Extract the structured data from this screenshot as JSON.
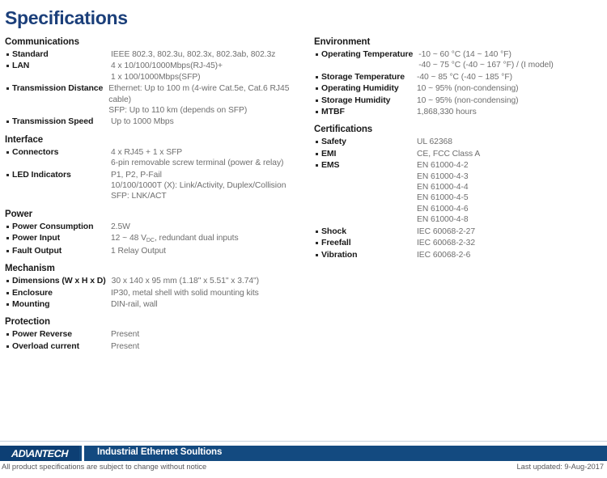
{
  "title": "Specifications",
  "theme": {
    "title_color": "#1b3f7a",
    "footer_bar_color": "#134a80",
    "logo_block_color": "#0d3f74",
    "label_color": "#1a1a1a",
    "value_color": "#6e6e6e"
  },
  "left_column": [
    {
      "heading": "Communications",
      "rows": [
        {
          "label": "Standard",
          "value": "IEEE 802.3, 802.3u, 802.3x, 802.3ab, 802.3z"
        },
        {
          "label": "LAN",
          "value": "4 x 10/100/1000Mbps(RJ-45)+\n1 x 100/1000Mbps(SFP)"
        },
        {
          "label": "Transmission Distance",
          "value": "Ethernet: Up to 100 m (4-wire Cat.5e, Cat.6 RJ45 cable)\nSFP: Up to 110 km (depends on SFP)",
          "wide": true
        },
        {
          "label": "Transmission Speed",
          "value": "Up to 1000 Mbps"
        }
      ]
    },
    {
      "heading": "Interface",
      "rows": [
        {
          "label": "Connectors",
          "value": "4 x RJ45 + 1 x SFP\n6-pin removable screw terminal (power & relay)"
        },
        {
          "label": "LED Indicators",
          "value": "P1, P2, P-Fail\n10/100/1000T (X): Link/Activity, Duplex/Collision\nSFP: LNK/ACT"
        }
      ]
    },
    {
      "heading": "Power",
      "rows": [
        {
          "label": "Power Consumption",
          "value": "2.5W"
        },
        {
          "label": "Power Input",
          "value_html": "12 ~ 48 V<sub>DC</sub>, redundant dual inputs"
        },
        {
          "label": "Fault Output",
          "value": "1 Relay Output"
        }
      ]
    },
    {
      "heading": "Mechanism",
      "rows": [
        {
          "label": "Dimensions (W x H x D)",
          "value": "30 x 140 x 95 mm (1.18\" x 5.51\" x 3.74\")",
          "wide": true
        },
        {
          "label": "Enclosure",
          "value": "IP30, metal shell with solid mounting kits"
        },
        {
          "label": "Mounting",
          "value": "DIN-rail, wall"
        }
      ]
    },
    {
      "heading": "Protection",
      "rows": [
        {
          "label": "Power Reverse",
          "value": "Present"
        },
        {
          "label": "Overload current",
          "value": "Present"
        }
      ]
    }
  ],
  "right_column": [
    {
      "heading": "Environment",
      "rows": [
        {
          "label": "Operating Temperature",
          "value": "-10 ~ 60 °C (14 ~ 140 °F)\n-40 ~ 75 °C (-40 ~ 167 °F) / (I model)",
          "wide": true
        },
        {
          "label": "Storage Temperature",
          "value": "-40 ~ 85 °C (-40 ~ 185 °F)"
        },
        {
          "label": "Operating Humidity",
          "value": "10 ~ 95% (non-condensing)"
        },
        {
          "label": "Storage Humidity",
          "value": "10 ~ 95% (non-condensing)"
        },
        {
          "label": "MTBF",
          "value": "1,868,330 hours"
        }
      ]
    },
    {
      "heading": "Certifications",
      "rows": [
        {
          "label": "Safety",
          "value": "UL 62368"
        },
        {
          "label": "EMI",
          "value": "CE, FCC Class A"
        },
        {
          "label": "EMS",
          "value": "EN 61000-4-2\nEN 61000-4-3\nEN 61000-4-4\nEN 61000-4-5\nEN 61000-4-6\nEN 61000-4-8"
        },
        {
          "label": "Shock",
          "value": "IEC 60068-2-27"
        },
        {
          "label": "Freefall",
          "value": "IEC 60068-2-32"
        },
        {
          "label": "Vibration",
          "value": "IEC 60068-2-6"
        }
      ]
    }
  ],
  "footer": {
    "logo": "AD\\ANTECH",
    "tagline": "Industrial Ethernet Soultions",
    "note": "All product specifications are subject to change without notice",
    "updated": "Last updated: 9-Aug-2017"
  }
}
